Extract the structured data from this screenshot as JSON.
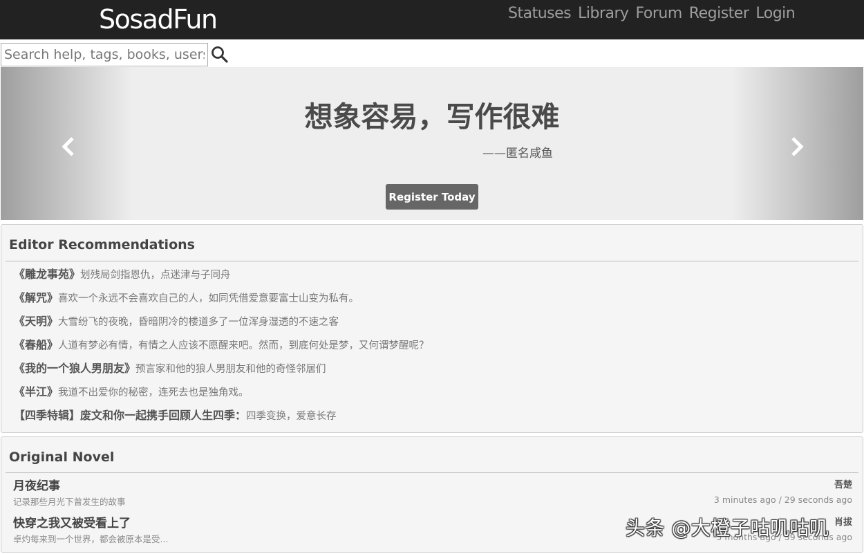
{
  "header": {
    "brand": "SosadFun",
    "nav": [
      {
        "label": "Statuses"
      },
      {
        "label": "Library"
      },
      {
        "label": "Forum"
      },
      {
        "label": "Register"
      },
      {
        "label": "Login"
      }
    ]
  },
  "search": {
    "placeholder": "Search help, tags, books, users...",
    "icon": "magnifier-icon"
  },
  "carousel": {
    "slogan": "想象容易，写作很难",
    "attribution": "——匿名咸鱼",
    "cta_label": "Register Today",
    "prev_icon": "chevron-left-icon",
    "next_icon": "chevron-right-icon"
  },
  "editor_recommendations": {
    "title": "Editor Recommendations",
    "items": [
      {
        "title": "《雕龙事苑》",
        "desc": "划残局剑指恩仇，点迷津与子同舟"
      },
      {
        "title": "《解咒》",
        "desc": "喜欢一个永远不会喜欢自己的人，如同凭借爱意要富士山变为私有。"
      },
      {
        "title": "《天明》",
        "desc": "大雪纷飞的夜晚，昏暗阴冷的楼道多了一位浑身湿透的不速之客"
      },
      {
        "title": "《春船》",
        "desc": "人道有梦必有情，有情之人应该不愿醒来吧。然而，到底何处是梦，又何谓梦醒呢？"
      },
      {
        "title": "《我的一个狼人男朋友》",
        "desc": "预言家和他的狼人男朋友和他的奇怪邻居们"
      },
      {
        "title": "《半江》",
        "desc": "我道不出爱你的秘密，连死去也是独角戏。"
      },
      {
        "title": "【四季特辑】废文和你一起携手回顾人生四季：",
        "desc": "四季变换，爱意长存"
      }
    ]
  },
  "original_novel": {
    "title": "Original Novel",
    "items": [
      {
        "title": "月夜纪事",
        "brief": "记录那些月光下曾发生的故事",
        "author": "吾楚",
        "time": "3 minutes ago / 29 seconds ago"
      },
      {
        "title": "快穿之我又被受看上了",
        "brief": "卓灼每来到一个世界，都会被原本是受...",
        "author": "肖拔",
        "time": "5 months ago / 59 seconds ago"
      }
    ]
  },
  "watermark": "头条 @大橙子咕叽咕叽",
  "colors": {
    "topbar": "#222222",
    "nav_text": "#9d9d9d",
    "carousel_bg": "#eeeeee",
    "button": "#666666",
    "panel_bg": "#f5f5f5"
  }
}
